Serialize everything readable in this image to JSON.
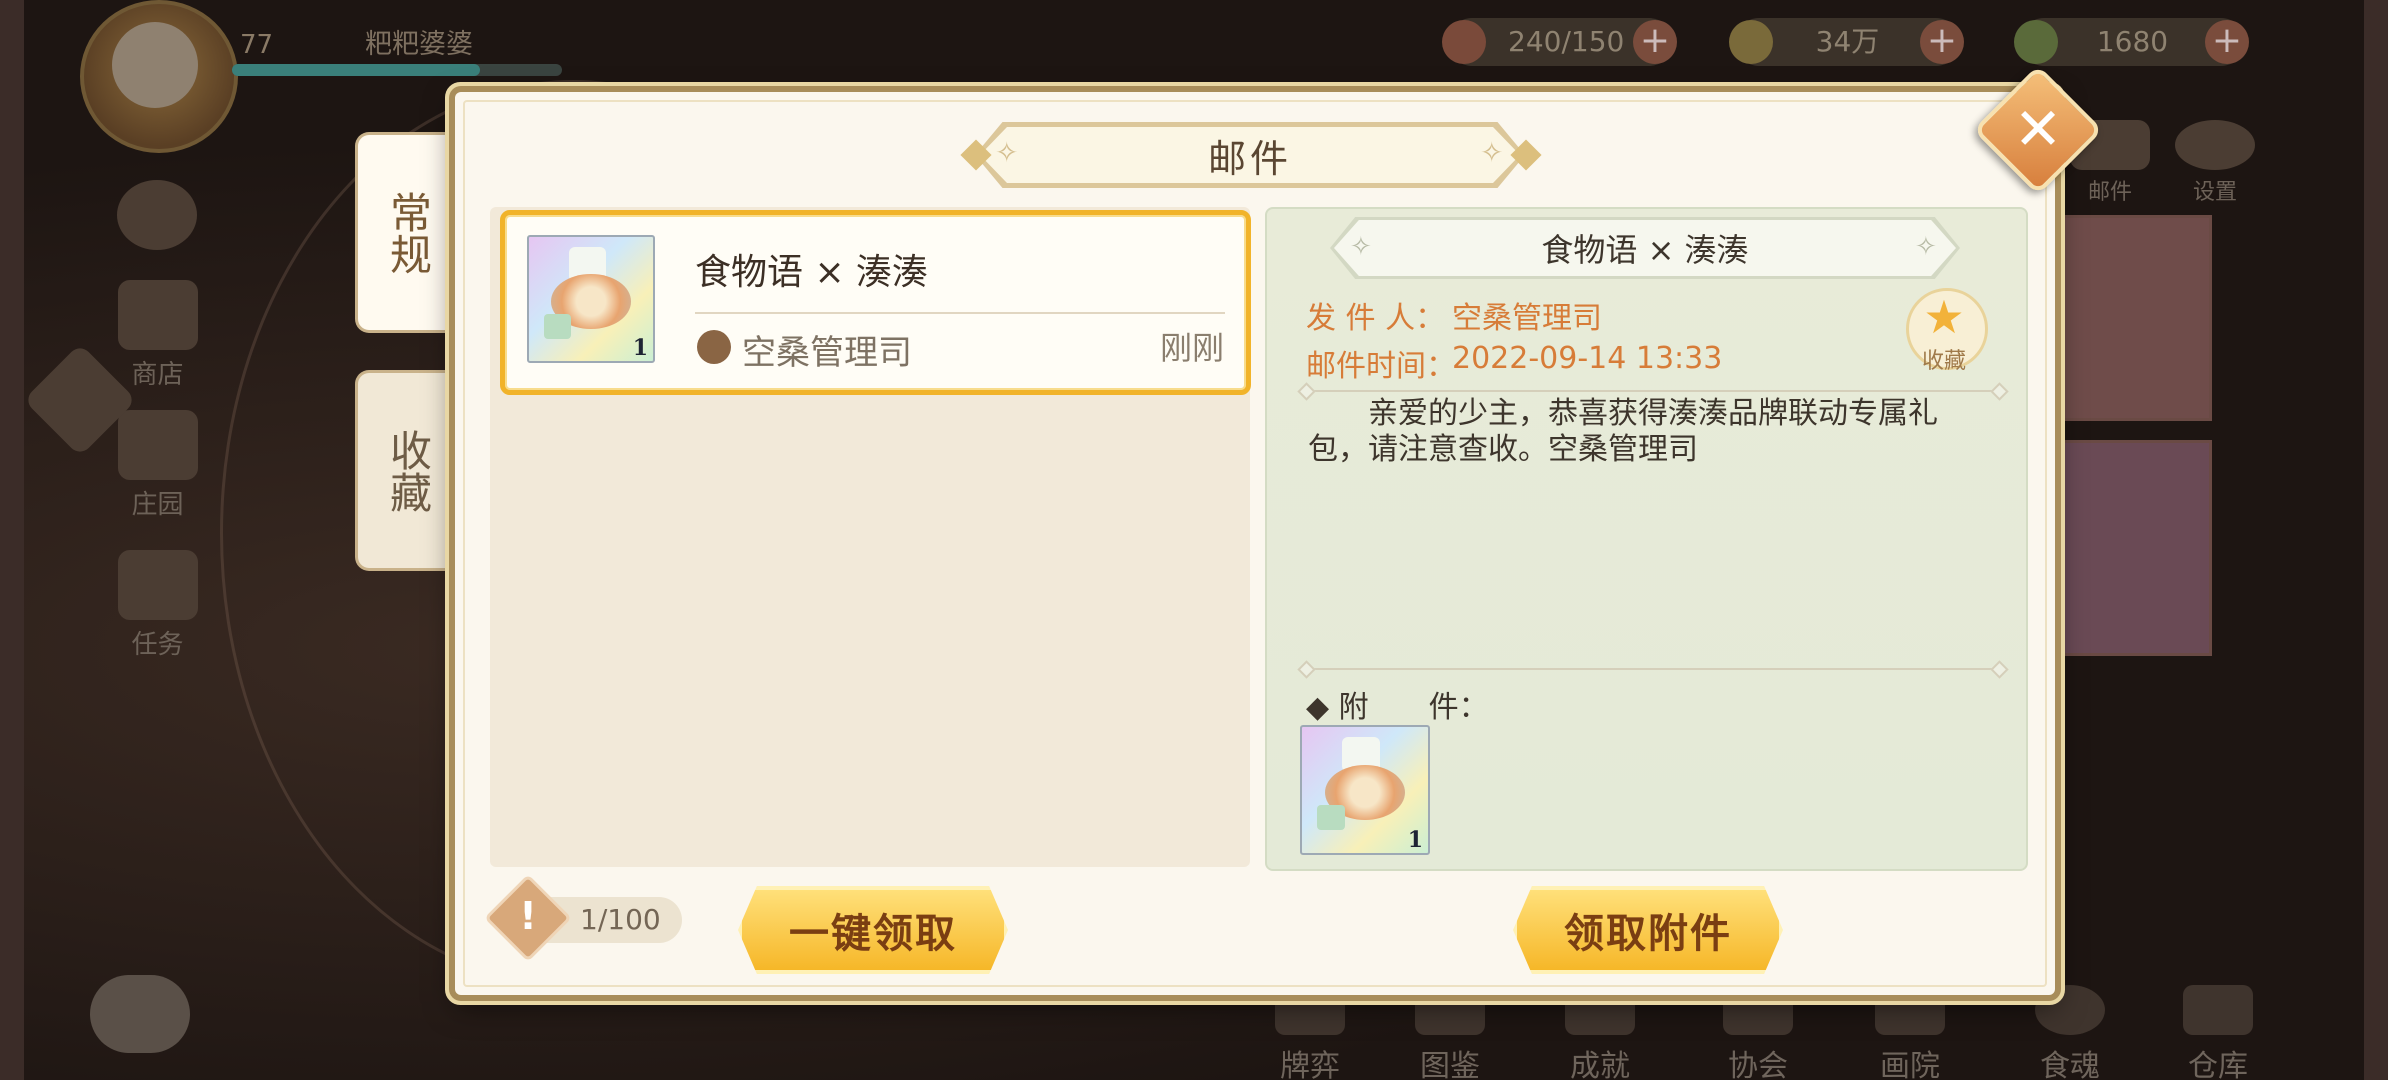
{
  "hud": {
    "level": "77",
    "player_name": "粑粑婆婆",
    "stamina": "240/150",
    "coins": "34万",
    "gems": "1680"
  },
  "side_menu": [
    "商店",
    "庄园",
    "任务"
  ],
  "top_right_icons": [
    "邮件",
    "设置"
  ],
  "bottom_nav": [
    "牌弈",
    "图鉴",
    "成就",
    "协会",
    "画院",
    "食魂",
    "仓库"
  ],
  "mail": {
    "title": "邮件",
    "tabs": [
      "常规",
      "收藏"
    ],
    "list": [
      {
        "title": "食物语 × 湊湊",
        "sender": "空桑管理司",
        "time": "刚刚",
        "item_count": "1"
      }
    ],
    "detail": {
      "title": "食物语 × 湊湊",
      "sender_label": "发 件 人：",
      "sender_value": "空桑管理司",
      "time_label": "邮件时间：",
      "time_value": "2022-09-14 13:33",
      "favorite_label": "收藏",
      "body": "亲爱的少主，恭喜获得湊湊品牌联动专属礼包，请注意查收。空桑管理司",
      "attachment_label": "◆ 附　　件：",
      "attachment_count": "1"
    },
    "counter": "1/100",
    "claim_all_button": "一键领取",
    "claim_attachment_button": "领取附件"
  },
  "colors": {
    "accent_gold": "#f6b728",
    "highlight_border": "#f1b32a",
    "orange_text": "#d77c38"
  }
}
